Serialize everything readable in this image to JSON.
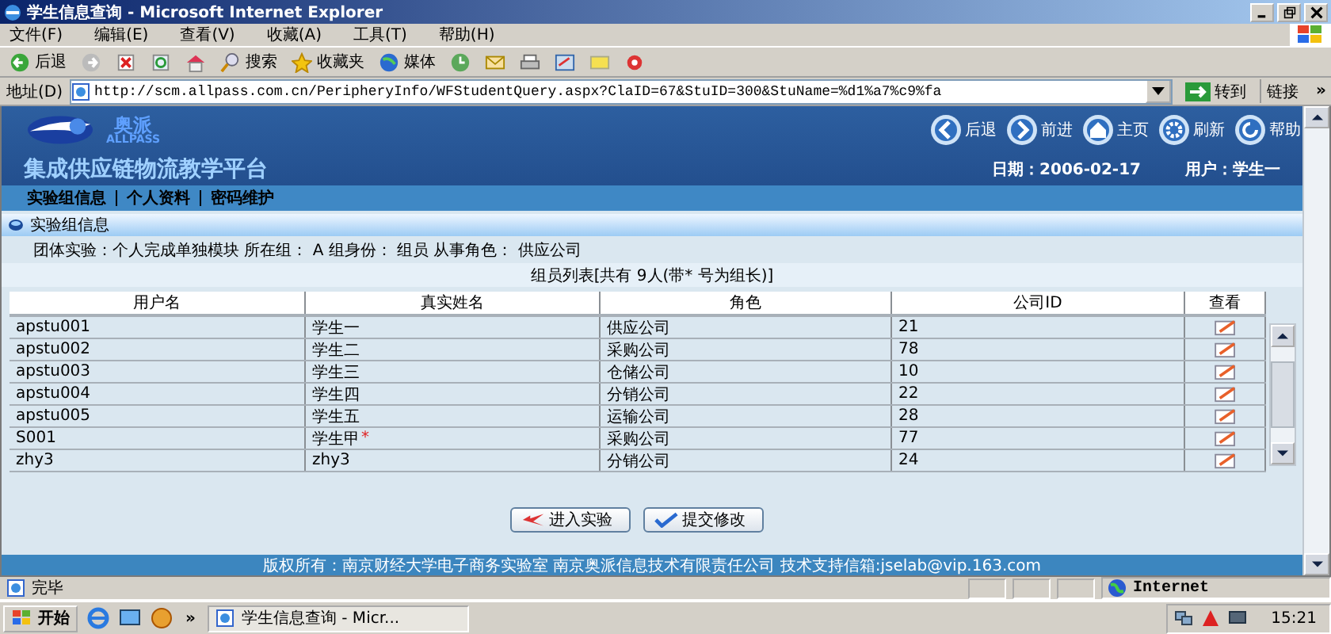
{
  "window": {
    "title": "学生信息查询 - Microsoft Internet Explorer"
  },
  "menu": [
    "文件(F)",
    "编辑(E)",
    "查看(V)",
    "收藏(A)",
    "工具(T)",
    "帮助(H)"
  ],
  "toolbar": [
    {
      "kind": "back",
      "label": "后退"
    },
    {
      "kind": "forward"
    },
    {
      "kind": "stop"
    },
    {
      "kind": "refresh"
    },
    {
      "kind": "home"
    },
    {
      "kind": "search",
      "label": "搜索"
    },
    {
      "kind": "favorites",
      "label": "收藏夹"
    },
    {
      "kind": "media",
      "label": "媒体"
    },
    {
      "kind": "history"
    },
    {
      "kind": "mail"
    },
    {
      "kind": "print"
    },
    {
      "kind": "edit"
    },
    {
      "kind": "discuss"
    },
    {
      "kind": "messenger"
    }
  ],
  "address": {
    "label": "地址(D)",
    "url": "http://scm.allpass.com.cn/PeripheryInfo/WFStudentQuery.aspx?ClaID=67&StuID=300&StuName=%d1%a7%c9%fa",
    "go": "转到",
    "links": "链接",
    "more": "»"
  },
  "site": {
    "logo_cn": "奥派",
    "logo_en": "ALLPASS",
    "platform": "集成供应链物流教学平台",
    "nav": [
      {
        "kind": "back",
        "label": "后退"
      },
      {
        "kind": "forward",
        "label": "前进"
      },
      {
        "kind": "home",
        "label": "主页"
      },
      {
        "kind": "refresh",
        "label": "刷新"
      },
      {
        "kind": "help",
        "label": "帮助"
      }
    ],
    "date": "日期：2006-02-17",
    "user": "用户：学生一",
    "tabs": [
      "实验组信息",
      "个人资料",
      "密码维护"
    ]
  },
  "section": {
    "title": "实验组信息",
    "info": "团体实验：个人完成单独模块 所在组： A 组身份： 组员 从事角色： 供应公司",
    "caption": "组员列表[共有 9人(带* 号为组长)]",
    "table": {
      "columns": [
        "用户名",
        "真实姓名",
        "角色",
        "公司ID",
        "查看"
      ],
      "rows": [
        {
          "username": "apstu001",
          "real_name": "学生一",
          "role": "供应公司",
          "company_id": "21"
        },
        {
          "username": "apstu002",
          "real_name": "学生二",
          "role": "采购公司",
          "company_id": "78"
        },
        {
          "username": "apstu003",
          "real_name": "学生三",
          "role": "仓储公司",
          "company_id": "10"
        },
        {
          "username": "apstu004",
          "real_name": "学生四",
          "role": "分销公司",
          "company_id": "22"
        },
        {
          "username": "apstu005",
          "real_name": "学生五",
          "role": "运输公司",
          "company_id": "28"
        },
        {
          "username": "S001",
          "real_name": "学生甲",
          "mark": "*",
          "role": "采购公司",
          "company_id": "77"
        },
        {
          "username": "zhy3",
          "real_name": "zhy3",
          "role": "分销公司",
          "company_id": "24"
        }
      ]
    },
    "buttons": [
      {
        "kind": "enter",
        "label": "进入实验"
      },
      {
        "kind": "submit",
        "label": "提交修改"
      }
    ],
    "footer": "版权所有：南京财经大学电子商务实验室 南京奥派信息技术有限责任公司 技术支持信箱:jselab@vip.163.com"
  },
  "status_bar": {
    "text": "完毕",
    "zone": "Internet"
  },
  "taskbar": {
    "start": "开始",
    "more": "»",
    "task": "学生信息查询 - Micr...",
    "clock": "15:21"
  }
}
